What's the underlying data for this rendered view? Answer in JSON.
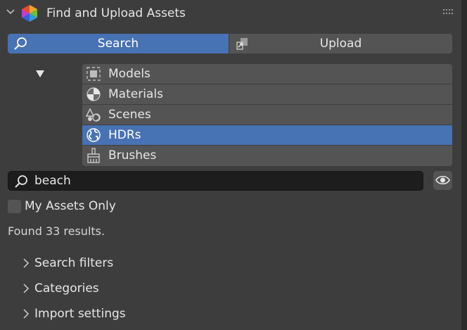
{
  "header": {
    "title": "Find and Upload Assets",
    "chevron_icon": "chevron-down-icon",
    "logo_icon": "blenderkit-hex-logo",
    "grip_icon": "drag-grip-icon"
  },
  "mode_tabs": [
    {
      "label": "Search",
      "icon": "search-icon",
      "selected": true
    },
    {
      "label": "Upload",
      "icon": "upload-icon",
      "selected": false
    }
  ],
  "asset_types": [
    {
      "label": "Models",
      "icon": "object-icon",
      "selected": false
    },
    {
      "label": "Materials",
      "icon": "material-icon",
      "selected": false
    },
    {
      "label": "Scenes",
      "icon": "scene-icon",
      "selected": false
    },
    {
      "label": "HDRs",
      "icon": "world-icon",
      "selected": true
    },
    {
      "label": "Brushes",
      "icon": "brush-icon",
      "selected": false
    }
  ],
  "search": {
    "value": "beach",
    "icon": "search-icon"
  },
  "my_assets_only": {
    "label": "My Assets Only",
    "checked": false
  },
  "results_text": "Found 33 results.",
  "sections": [
    {
      "label": "Search filters",
      "expanded": false
    },
    {
      "label": "Categories",
      "expanded": false
    },
    {
      "label": "Import settings",
      "expanded": false
    }
  ],
  "colors": {
    "accent": "#4772b3",
    "panel_bg": "#3d3d3d",
    "button_bg": "#545454",
    "field_bg": "#1d1d1d"
  }
}
